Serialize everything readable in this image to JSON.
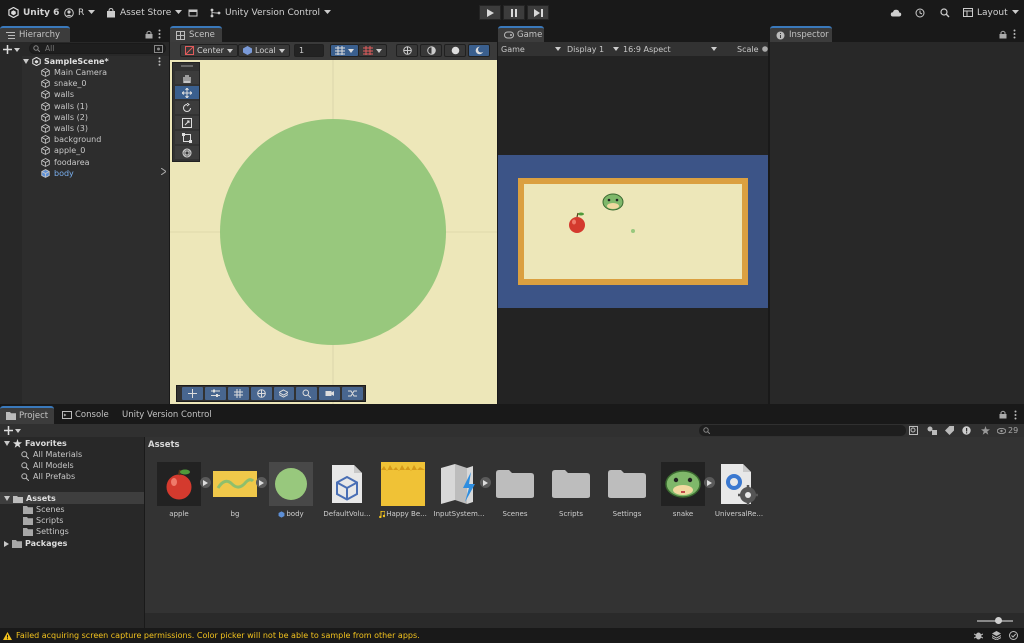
{
  "toolbar": {
    "app_name": "Unity 6",
    "account_label": "R",
    "asset_store_label": "Asset Store",
    "version_control_label": "Unity Version Control",
    "layout_label": "Layout"
  },
  "hierarchy": {
    "tab_label": "Hierarchy",
    "search_placeholder": "All",
    "scene_name": "SampleScene*",
    "items": [
      {
        "label": "Main Camera"
      },
      {
        "label": "snake_0"
      },
      {
        "label": "walls"
      },
      {
        "label": "walls (1)"
      },
      {
        "label": "walls (2)"
      },
      {
        "label": "walls (3)"
      },
      {
        "label": "background"
      },
      {
        "label": "apple_0"
      },
      {
        "label": "foodarea"
      },
      {
        "label": "body",
        "selected_color": "#7ab0f0"
      }
    ]
  },
  "scene": {
    "tab_label": "Scene",
    "pivot_label": "Center",
    "space_label": "Local",
    "snap_value": "1",
    "background_color": "#ede7b9",
    "circle_color": "#98c87d"
  },
  "game": {
    "tab_label": "Game",
    "view_label": "Game",
    "display_label": "Display 1",
    "aspect_label": "16:9 Aspect",
    "scale_label": "Scale",
    "border_color": "#3c5487",
    "wall_color": "#dba040",
    "field_color": "#ede7b9"
  },
  "inspector": {
    "tab_label": "Inspector"
  },
  "project": {
    "tabs": [
      {
        "label": "Project"
      },
      {
        "label": "Console"
      },
      {
        "label": "Unity Version Control"
      }
    ],
    "hidden_count": "29",
    "favorites_label": "Favorites",
    "favorites": [
      {
        "label": "All Materials"
      },
      {
        "label": "All Models"
      },
      {
        "label": "All Prefabs"
      }
    ],
    "assets_root": "Assets",
    "asset_folders": [
      {
        "label": "Scenes"
      },
      {
        "label": "Scripts"
      },
      {
        "label": "Settings"
      }
    ],
    "packages_label": "Packages",
    "breadcrumb": "Assets",
    "assets": [
      {
        "label": "apple",
        "icon": "apple-icon"
      },
      {
        "label": "bg",
        "icon": "snake-bg-icon"
      },
      {
        "label": "body",
        "icon": "circle-icon"
      },
      {
        "label": "DefaultVolu...",
        "icon": "volume-profile-icon"
      },
      {
        "label": "Happy Be...",
        "icon": "audio-icon"
      },
      {
        "label": "InputSystem...",
        "icon": "input-actions-icon"
      },
      {
        "label": "Scenes",
        "icon": "folder-icon"
      },
      {
        "label": "Scripts",
        "icon": "folder-icon"
      },
      {
        "label": "Settings",
        "icon": "folder-icon"
      },
      {
        "label": "snake",
        "icon": "snake-head-icon"
      },
      {
        "label": "UniversalRe...",
        "icon": "render-pipeline-icon"
      }
    ]
  },
  "status": {
    "message": "Failed acquiring screen capture permissions. Color picker will not be able to sample from other apps."
  }
}
